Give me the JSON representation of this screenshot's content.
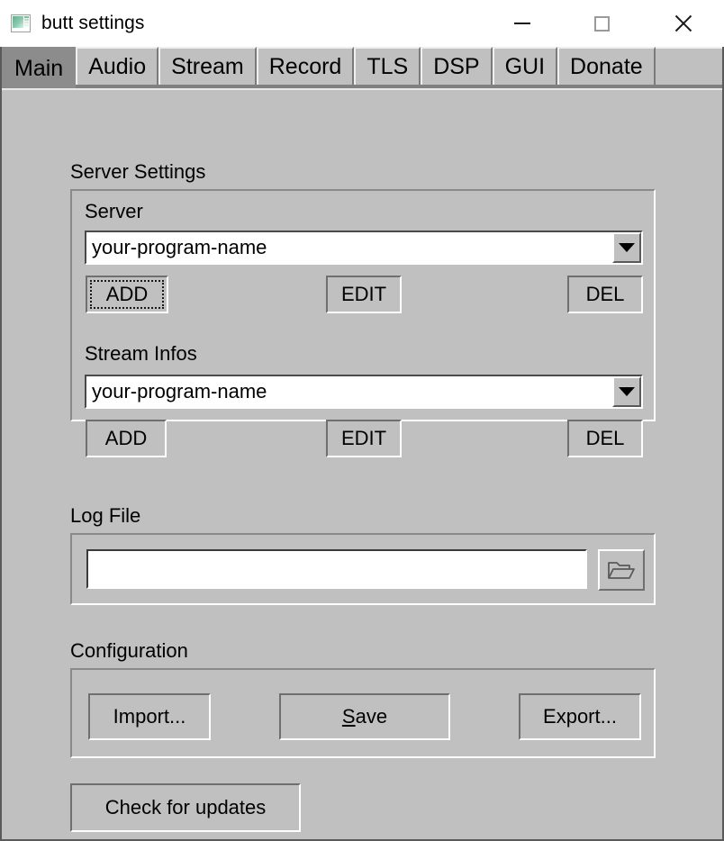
{
  "window": {
    "title": "butt settings",
    "icon": "app-window-icon",
    "controls": {
      "minimize": "minimize-icon",
      "maximize": "maximize-icon",
      "close": "close-icon"
    }
  },
  "colors": {
    "face": "#c0c0c0",
    "tab_selected": "#8c8c8c",
    "tabbar_bg": "#808080",
    "titlebar_bg": "#ffffff",
    "text": "#000000",
    "field_bg": "#ffffff",
    "border_dark": "#6f6f6f",
    "border_light": "#ffffff"
  },
  "tabs": [
    {
      "label": "Main",
      "selected": true
    },
    {
      "label": "Audio",
      "selected": false
    },
    {
      "label": "Stream",
      "selected": false
    },
    {
      "label": "Record",
      "selected": false
    },
    {
      "label": "TLS",
      "selected": false
    },
    {
      "label": "DSP",
      "selected": false
    },
    {
      "label": "GUI",
      "selected": false
    },
    {
      "label": "Donate",
      "selected": false
    }
  ],
  "server_settings": {
    "section_label": "Server Settings",
    "server": {
      "label": "Server",
      "selected_value": "your-program-name",
      "dropdown_icon": "chevron-down-icon",
      "add_label": "ADD",
      "edit_label": "EDIT",
      "del_label": "DEL",
      "add_focused": true
    },
    "stream_infos": {
      "label": "Stream Infos",
      "selected_value": "your-program-name",
      "dropdown_icon": "chevron-down-icon",
      "add_label": "ADD",
      "edit_label": "EDIT",
      "del_label": "DEL",
      "add_focused": false
    }
  },
  "log_file": {
    "section_label": "Log File",
    "path_value": "",
    "path_placeholder": "",
    "browse_icon": "folder-open-icon"
  },
  "configuration": {
    "section_label": "Configuration",
    "import_label": "Import...",
    "save_label_prefix": "",
    "save_label_accel": "S",
    "save_label_suffix": "ave",
    "export_label": "Export..."
  },
  "updates": {
    "check_label": "Check for updates"
  }
}
